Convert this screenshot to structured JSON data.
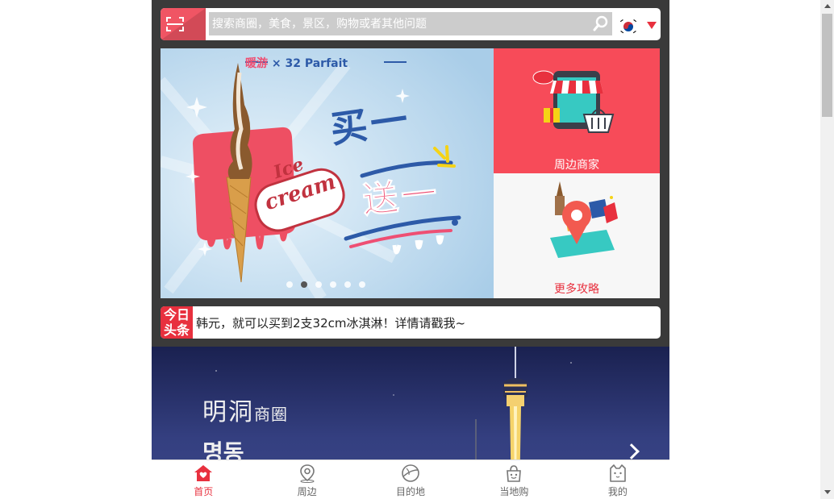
{
  "search": {
    "placeholder": "搜索商圈，美食，景区，购物或者其他问题"
  },
  "language": {
    "current_flag": "korea-flag-icon"
  },
  "banner": {
    "header_left": "暖游",
    "header_mid": " × ",
    "header_right": "32 Parfait",
    "word_ice": "Ice",
    "word_cream": "cream",
    "headline_top": "买一",
    "headline_bottom": "送一",
    "slide_count": 6,
    "active_slide": 2
  },
  "tiles": [
    {
      "label": "周边商家",
      "icon": "shop-cart-icon"
    },
    {
      "label": "更多攻略",
      "icon": "map-pin-landmarks-icon"
    }
  ],
  "news": {
    "tag_line1": "今日",
    "tag_line2": "头条",
    "text": "韩元，就可以买到2支32cm冰淇淋！详情请戳我~"
  },
  "feature": {
    "title": "明洞",
    "title_suffix": "商圈",
    "subtitle": "명동"
  },
  "tabbar": {
    "items": [
      {
        "label": "首页",
        "icon": "home-icon",
        "active": true
      },
      {
        "label": "周边",
        "icon": "location-pin-icon",
        "active": false
      },
      {
        "label": "目的地",
        "icon": "planet-icon",
        "active": false
      },
      {
        "label": "当地购",
        "icon": "shopping-bag-icon",
        "active": false
      },
      {
        "label": "我的",
        "icon": "profile-cat-icon",
        "active": false
      }
    ]
  },
  "colors": {
    "accent": "#e8303e",
    "tile_red": "#f74b59",
    "app_bg": "#3a3a3a",
    "search_field": "#cccccc"
  }
}
